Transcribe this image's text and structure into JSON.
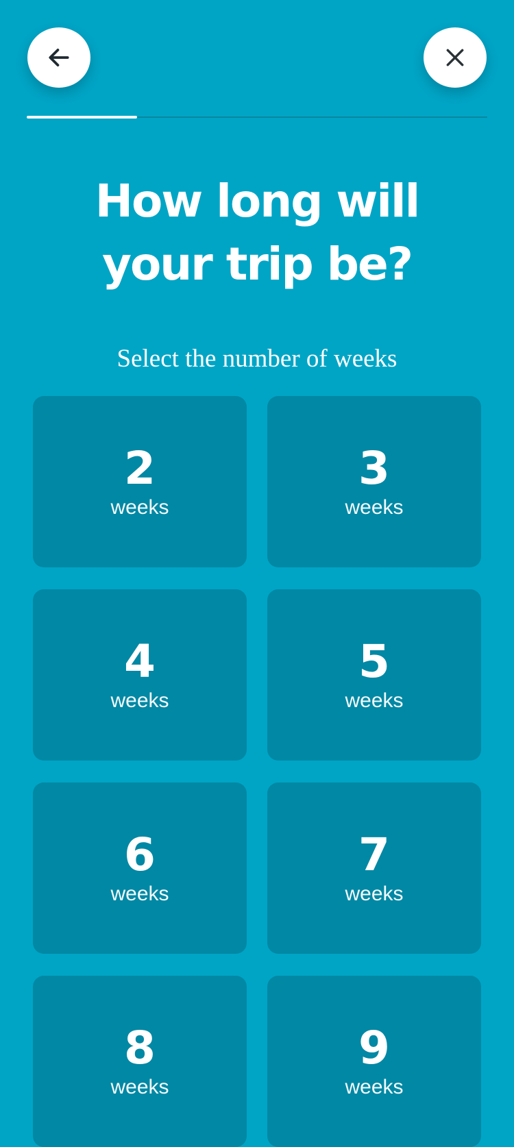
{
  "header": {
    "back_icon": "arrow-left-icon",
    "close_icon": "close-x-icon"
  },
  "progress": {
    "fraction": 0.24
  },
  "main": {
    "title_line1": "How long will",
    "title_line2": "your trip be?",
    "subtitle": "Select the number of weeks"
  },
  "options": [
    {
      "number": "2",
      "unit": "weeks"
    },
    {
      "number": "3",
      "unit": "weeks"
    },
    {
      "number": "4",
      "unit": "weeks"
    },
    {
      "number": "5",
      "unit": "weeks"
    },
    {
      "number": "6",
      "unit": "weeks"
    },
    {
      "number": "7",
      "unit": "weeks"
    },
    {
      "number": "8",
      "unit": "weeks"
    },
    {
      "number": "9",
      "unit": "weeks"
    }
  ],
  "colors": {
    "background": "#00a5c6",
    "tile": "#0088a4",
    "button": "#ffffff"
  }
}
